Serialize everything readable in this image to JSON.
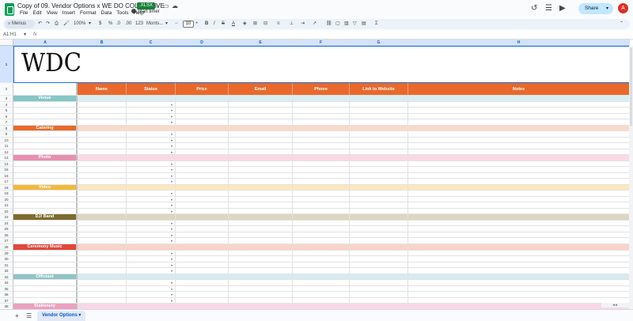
{
  "document": {
    "title": "Copy of 09. Vendor Options  x WE DO COLLECTIVE",
    "format_badge": ".XLSX",
    "timer_label": "Start timer"
  },
  "menu": [
    "File",
    "Edit",
    "View",
    "Insert",
    "Format",
    "Data",
    "Tools",
    "Help"
  ],
  "header_right": {
    "share_label": "Share",
    "avatar_letter": "A"
  },
  "toolbar": {
    "search_placeholder": "Menus",
    "zoom": "100%",
    "currency": "$",
    "percent": "%",
    "decimal_decrease": ".0",
    "decimal_increase": ".00",
    "number_format": "123",
    "font": "Monts...",
    "font_size": "10"
  },
  "formula_bar": {
    "cell_ref": "A1:H1",
    "fx": "fx"
  },
  "columns": [
    "A",
    "B",
    "C",
    "D",
    "E",
    "F",
    "G",
    "H"
  ],
  "logo_text": "WDC",
  "table_headers": [
    "Name",
    "Status",
    "Price",
    "Email",
    "Phone",
    "Link to Website",
    "Notes"
  ],
  "categories": [
    {
      "row": 3,
      "label": "Venue",
      "color": "#86c6c7",
      "tint": "#d9eef0"
    },
    {
      "row": 8,
      "label": "Catering",
      "color": "#e8692b",
      "tint": "#fbd9c7"
    },
    {
      "row": 13,
      "label": "Photo",
      "color": "#e88fb0",
      "tint": "#fad8e4"
    },
    {
      "row": 18,
      "label": "Video",
      "color": "#f2b93b",
      "tint": "#fbe8bd"
    },
    {
      "row": 23,
      "label": "DJ/  Band",
      "color": "#7d6b2c",
      "tint": "#ddd6c1"
    },
    {
      "row": 28,
      "label": "Ceremony Music",
      "color": "#e2473b",
      "tint": "#f9d3c8"
    },
    {
      "row": 33,
      "label": "Officiant",
      "color": "#8fc3c9",
      "tint": "#d5ecef"
    },
    {
      "row": 38,
      "label": "Stationery",
      "color": "#eba0c0",
      "tint": "#f9d8e6"
    }
  ],
  "row_numbers": [
    "1",
    "2",
    "3",
    "4",
    "5",
    "6",
    "7",
    "8",
    "9",
    "10",
    "11",
    "12",
    "13",
    "14",
    "15",
    "16",
    "17",
    "18",
    "19",
    "20",
    "21",
    "22",
    "23",
    "24",
    "25",
    "26",
    "27",
    "28",
    "29",
    "30",
    "31",
    "32",
    "33",
    "34",
    "35",
    "36",
    "37",
    "38"
  ],
  "sheet_tab": "Vendor Options",
  "header_color": "#e8692b"
}
